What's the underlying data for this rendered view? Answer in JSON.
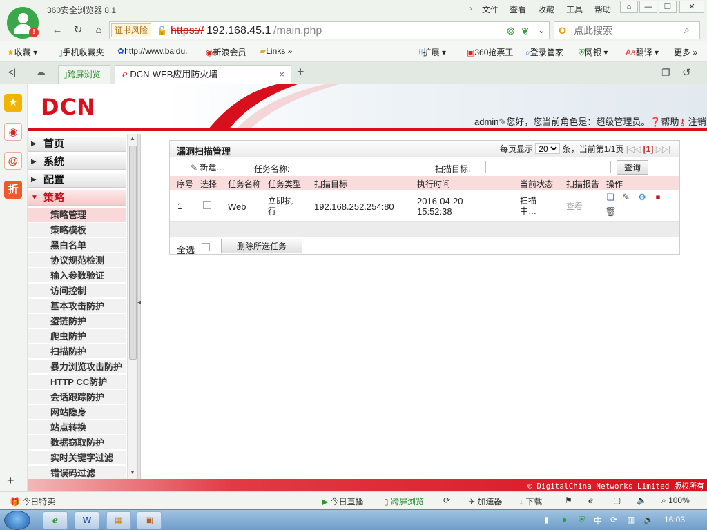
{
  "browser": {
    "app_title": "360安全浏览器 8.1",
    "menu": [
      "文件",
      "查看",
      "收藏",
      "工具",
      "帮助"
    ],
    "cert_warning": "证书风险",
    "url_protocol": "https://",
    "url_host": "192.168.45.1",
    "url_path": "/main.php",
    "search_placeholder": "点此搜索",
    "bookmarks": [
      "收藏",
      "手机收藏夹",
      "http://www.baidu.",
      "新浪会员",
      "Links",
      "扩展",
      "360抢票王",
      "登录管家",
      "网银",
      "翻译",
      "更多"
    ],
    "tabs": [
      {
        "label": "跨屏浏览"
      },
      {
        "label": "DCN-WEB应用防火墙"
      }
    ]
  },
  "app": {
    "logo": "DCN",
    "user": "admin",
    "greeting": "您好，您当前角色是：超级管理员。",
    "help": "帮助",
    "logout": "注销",
    "footer": "© DigitalChina Networks Limited 版权所有"
  },
  "sidebar": {
    "top": [
      {
        "label": "首页",
        "open": false
      },
      {
        "label": "系统",
        "open": false
      },
      {
        "label": "配置",
        "open": false
      },
      {
        "label": "策略",
        "open": true
      }
    ],
    "sub": [
      "策略管理",
      "策略模板",
      "黑白名单",
      "协议规范检测",
      "输入参数验证",
      "访问控制",
      "基本攻击防护",
      "盗链防护",
      "爬虫防护",
      "扫描防护",
      "暴力浏览攻击防护",
      "HTTP CC防护",
      "会话跟踪防护",
      "网站隐身",
      "站点转换",
      "数据窃取防护",
      "实时关键字过滤",
      "错误码过滤"
    ],
    "active_index": 0
  },
  "panel": {
    "title": "漏洞扫描管理",
    "pager_prefix": "每页显示",
    "page_size": "20",
    "pager_suffix": "条，当前第1/1页",
    "page_current": "[1]",
    "new_label": "新建…",
    "task_name_label": "任务名称:",
    "scan_target_label": "扫描目标:",
    "query_label": "查询",
    "headers": [
      "序号",
      "选择",
      "任务名称",
      "任务类型",
      "扫描目标",
      "执行时间",
      "当前状态",
      "扫描报告",
      "操作"
    ],
    "rows": [
      {
        "index": "1",
        "name": "Web",
        "type_line1": "立即执",
        "type_line2": "行",
        "target": "192.168.252.254:80",
        "time_line1": "2016-04-20",
        "time_line2": "15:52:38",
        "status_line1": "扫描",
        "status_line2": "中…",
        "report": "查看"
      }
    ],
    "select_all": "全选",
    "delete_selected": "删除所选任务"
  },
  "statusbar": {
    "left": "今日特卖",
    "live": "今日直播",
    "split": "跨屏浏览",
    "accelerator": "加速器",
    "download": "下载",
    "zoom": "100%"
  },
  "taskbar": {
    "clock": "16:03"
  }
}
